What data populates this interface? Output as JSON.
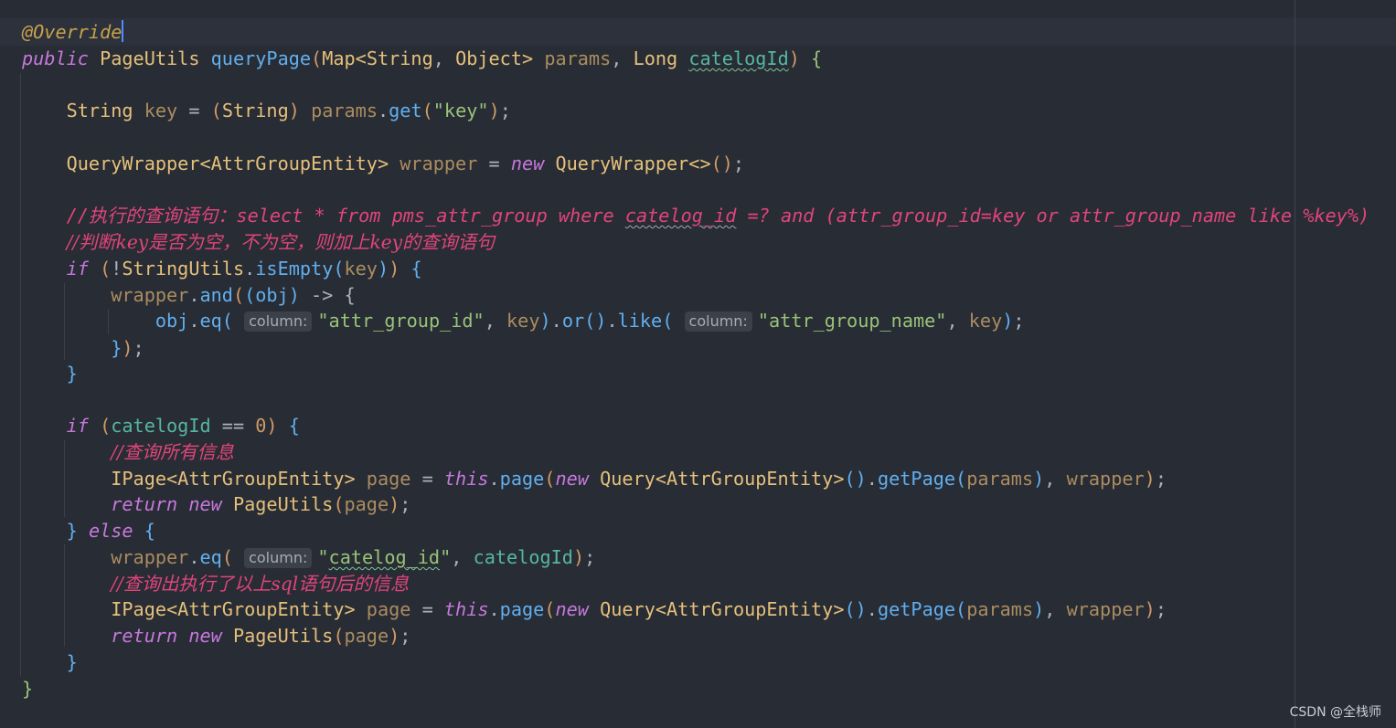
{
  "watermark": "CSDN @全栈师",
  "code": {
    "annotation": "@Override",
    "kw_public": "public",
    "kw_if": "if",
    "kw_new": "new",
    "kw_this": "this",
    "kw_return": "return",
    "kw_else": "else",
    "t_PageUtils": "PageUtils",
    "t_Map": "Map",
    "t_String": "String",
    "t_Object": "Object",
    "t_Long": "Long",
    "t_QueryWrapper": "QueryWrapper",
    "t_AttrGroupEntity": "AttrGroupEntity",
    "t_StringUtils": "StringUtils",
    "t_IPage": "IPage",
    "t_Query": "Query",
    "m_queryPage": "queryPage",
    "m_get": "get",
    "m_isEmpty": "isEmpty",
    "m_and": "and",
    "m_eq": "eq",
    "m_or": "or",
    "m_like": "like",
    "m_page": "page",
    "m_getPage": "getPage",
    "v_params": "params",
    "v_catelogId": "catelogId",
    "v_key": "key",
    "v_wrapper": "wrapper",
    "v_obj": "obj",
    "v_page": "page",
    "s_key": "\"key\"",
    "s_attr_group_id": "\"attr_group_id\"",
    "s_attr_group_name": "\"attr_group_name\"",
    "s_catelog_id_q": "\"",
    "s_catelog_id": "catelog_id",
    "n_zero": "0",
    "hint_column": "column:",
    "c1_a": "//执行的查询语句：select * from pms_attr_group where ",
    "c1_b": "catelog_id",
    "c1_c": " =? and (attr_group_id=key or attr_group_name like %key%)",
    "c2": "//判断key是否为空，不为空，则加上key的查询语句",
    "c3": "//查询所有信息",
    "c4": "//查询出执行了以上sql语句后的信息"
  }
}
